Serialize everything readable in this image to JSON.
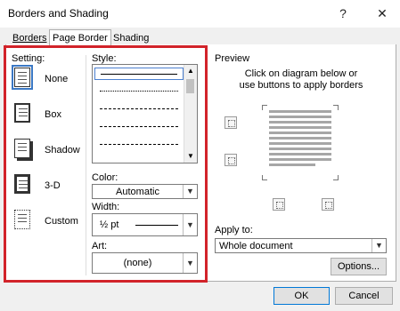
{
  "window": {
    "title": "Borders and Shading",
    "help_icon": "?",
    "close_icon": "✕"
  },
  "tabs": [
    {
      "label": "Borders",
      "selected": false
    },
    {
      "label": "Page Border",
      "selected": true
    },
    {
      "label": "Shading",
      "selected": false
    }
  ],
  "setting": {
    "label": "Setting:",
    "items": [
      {
        "label": "None",
        "icon": "none-setting-icon",
        "selected": true
      },
      {
        "label": "Box",
        "icon": "box-setting-icon",
        "selected": false
      },
      {
        "label": "Shadow",
        "icon": "shadow-setting-icon",
        "selected": false
      },
      {
        "label": "3-D",
        "icon": "3d-setting-icon",
        "selected": false
      },
      {
        "label": "Custom",
        "icon": "custom-setting-icon",
        "selected": false
      }
    ]
  },
  "style": {
    "label": "Style:",
    "lines": [
      "solid",
      "dotted",
      "dashed-small",
      "dashed",
      "dash-dot"
    ],
    "selected_index": 0
  },
  "color": {
    "label": "Color:",
    "value": "Automatic"
  },
  "width": {
    "label": "Width:",
    "value": "½ pt"
  },
  "art": {
    "label": "Art:",
    "value": "(none)"
  },
  "preview": {
    "label": "Preview",
    "instruction_line1": "Click on diagram below or",
    "instruction_line2": "use buttons to apply borders"
  },
  "apply_to": {
    "label": "Apply to:",
    "value": "Whole document"
  },
  "buttons": {
    "options": "Options...",
    "ok": "OK",
    "cancel": "Cancel"
  },
  "colors": {
    "highlight_box": "#d2232a",
    "selection": "#3b78c4",
    "default_button_border": "#0078d7"
  }
}
